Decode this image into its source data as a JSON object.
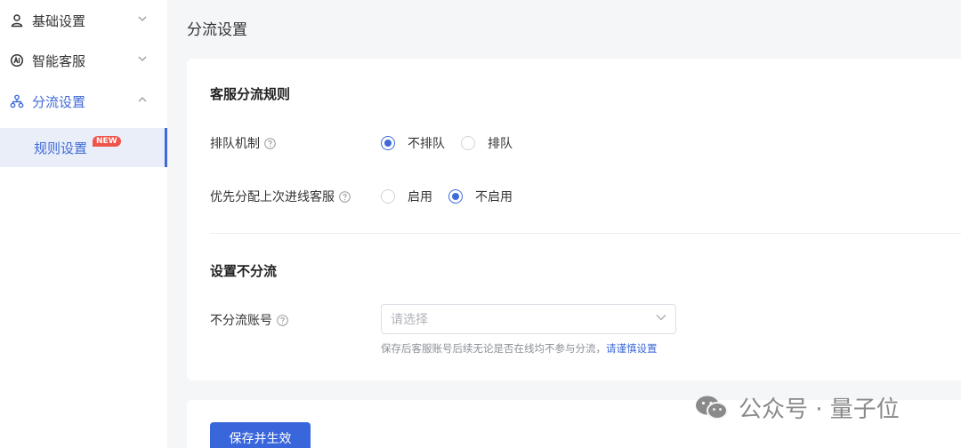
{
  "sidebar": {
    "items": [
      {
        "label": "基础设置",
        "icon": "user-group-icon",
        "expanded": false
      },
      {
        "label": "智能客服",
        "icon": "ai-bot-icon",
        "expanded": false
      },
      {
        "label": "分流设置",
        "icon": "org-tree-icon",
        "expanded": true
      }
    ],
    "subitem": {
      "label": "规则设置",
      "badge": "NEW"
    }
  },
  "page": {
    "title": "分流设置"
  },
  "rules_section": {
    "title": "客服分流规则",
    "queue": {
      "label": "排队机制",
      "options": [
        "不排队",
        "排队"
      ],
      "selected": "不排队"
    },
    "priority": {
      "label": "优先分配上次进线客服",
      "options": [
        "启用",
        "不启用"
      ],
      "selected": "不启用"
    }
  },
  "no_split_section": {
    "title": "设置不分流",
    "field_label": "不分流账号",
    "placeholder": "请选择",
    "hint": "保存后客服账号后续无论是否在线均不参与分流，",
    "hint_link": "请谨慎设置"
  },
  "footer": {
    "save_label": "保存并生效"
  },
  "watermark": {
    "text": "公众号 · 量子位"
  },
  "colors": {
    "accent": "#3f6ad8",
    "badge": "#f0534a"
  }
}
